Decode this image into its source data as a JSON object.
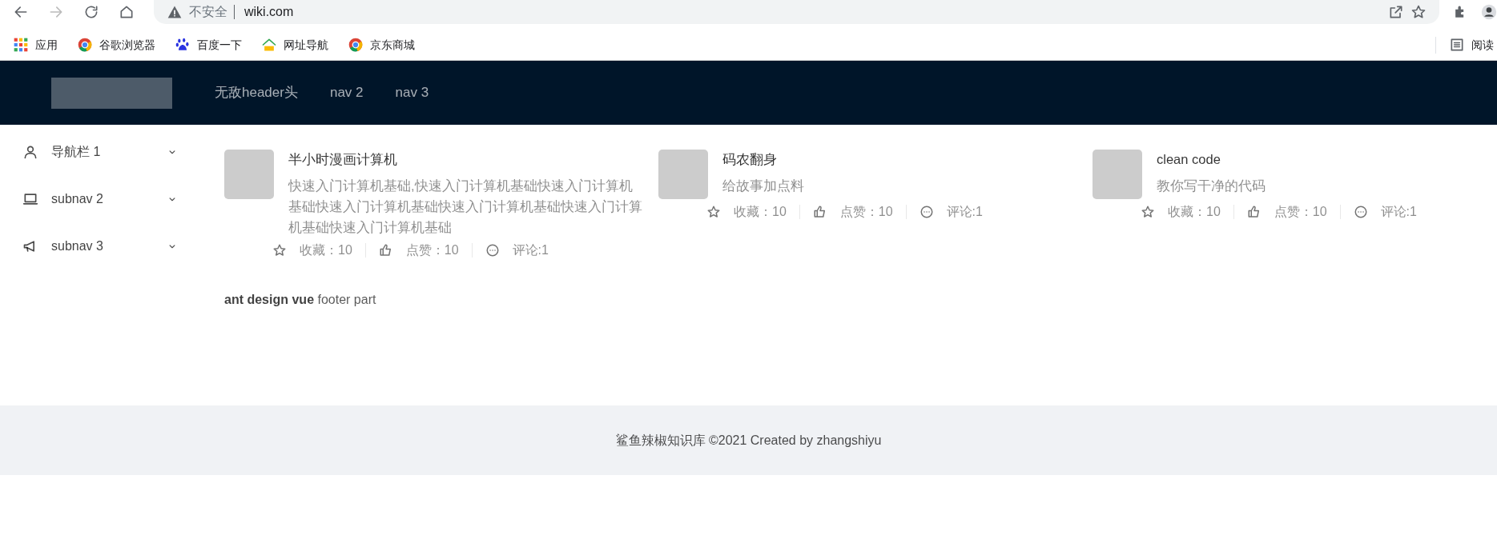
{
  "browser": {
    "security": "不安全",
    "url": "wiki.com",
    "bookmarks": [
      "应用",
      "谷歌浏览器",
      "百度一下",
      "网址导航",
      "京东商城"
    ],
    "reading_list": "阅读"
  },
  "header": {
    "nav": [
      "无敌header头",
      "nav 2",
      "nav 3"
    ]
  },
  "sidebar": {
    "items": [
      {
        "label": "导航栏 1",
        "expanded": false
      },
      {
        "label": "subnav 2",
        "expanded": false
      },
      {
        "label": "subnav 3",
        "expanded": false
      }
    ]
  },
  "articles": [
    {
      "title": "半小时漫画计算机",
      "description": "快速入门计算机基础,快速入门计算机基础快速入门计算机基础快速入门计算机基础快速入门计算机基础快速入门计算机基础快速入门计算机基础",
      "actions": [
        "收藏：10",
        "点赞：10",
        "评论:1"
      ]
    },
    {
      "title": "码农翻身",
      "description": "给故事加点料",
      "actions": [
        "收藏：10",
        "点赞：10",
        "评论:1"
      ]
    },
    {
      "title": "clean code",
      "description": "教你写干净的代码",
      "actions": [
        "收藏：10",
        "点赞：10",
        "评论:1"
      ]
    }
  ],
  "content_footer": "**ant design vue** footer part",
  "footer": "鲨鱼辣椒知识库 ©2021 Created by zhangshiyu"
}
